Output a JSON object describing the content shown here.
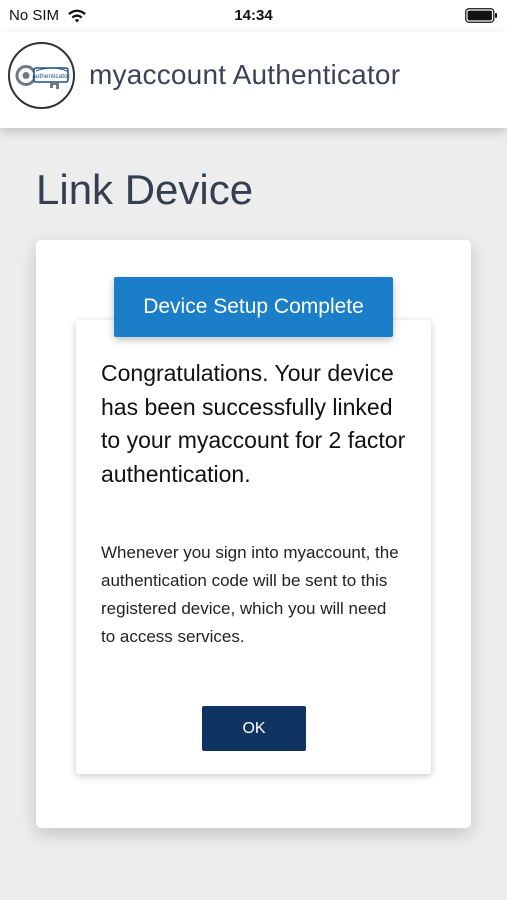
{
  "status_bar": {
    "carrier": "No SIM",
    "time": "14:34",
    "wifi_icon": "wifi-icon",
    "battery_icon": "battery-icon"
  },
  "header": {
    "logo_icon": "authenticator-key-logo",
    "logo_text": "authenticator",
    "title": "myaccount Authenticator"
  },
  "page": {
    "title": "Link Device"
  },
  "dialog": {
    "header": "Device Setup Complete",
    "heading": "Congratulations. Your device has been successfully linked to your myaccount for 2 factor authentication.",
    "body": "Whenever you sign into myaccount, the authentication code will be sent to this registered device, which you will need to access services.",
    "ok_label": "OK"
  },
  "colors": {
    "accent": "#1a7ec9",
    "button": "#0f3461",
    "title_text": "#34404f",
    "background": "#ededed"
  }
}
